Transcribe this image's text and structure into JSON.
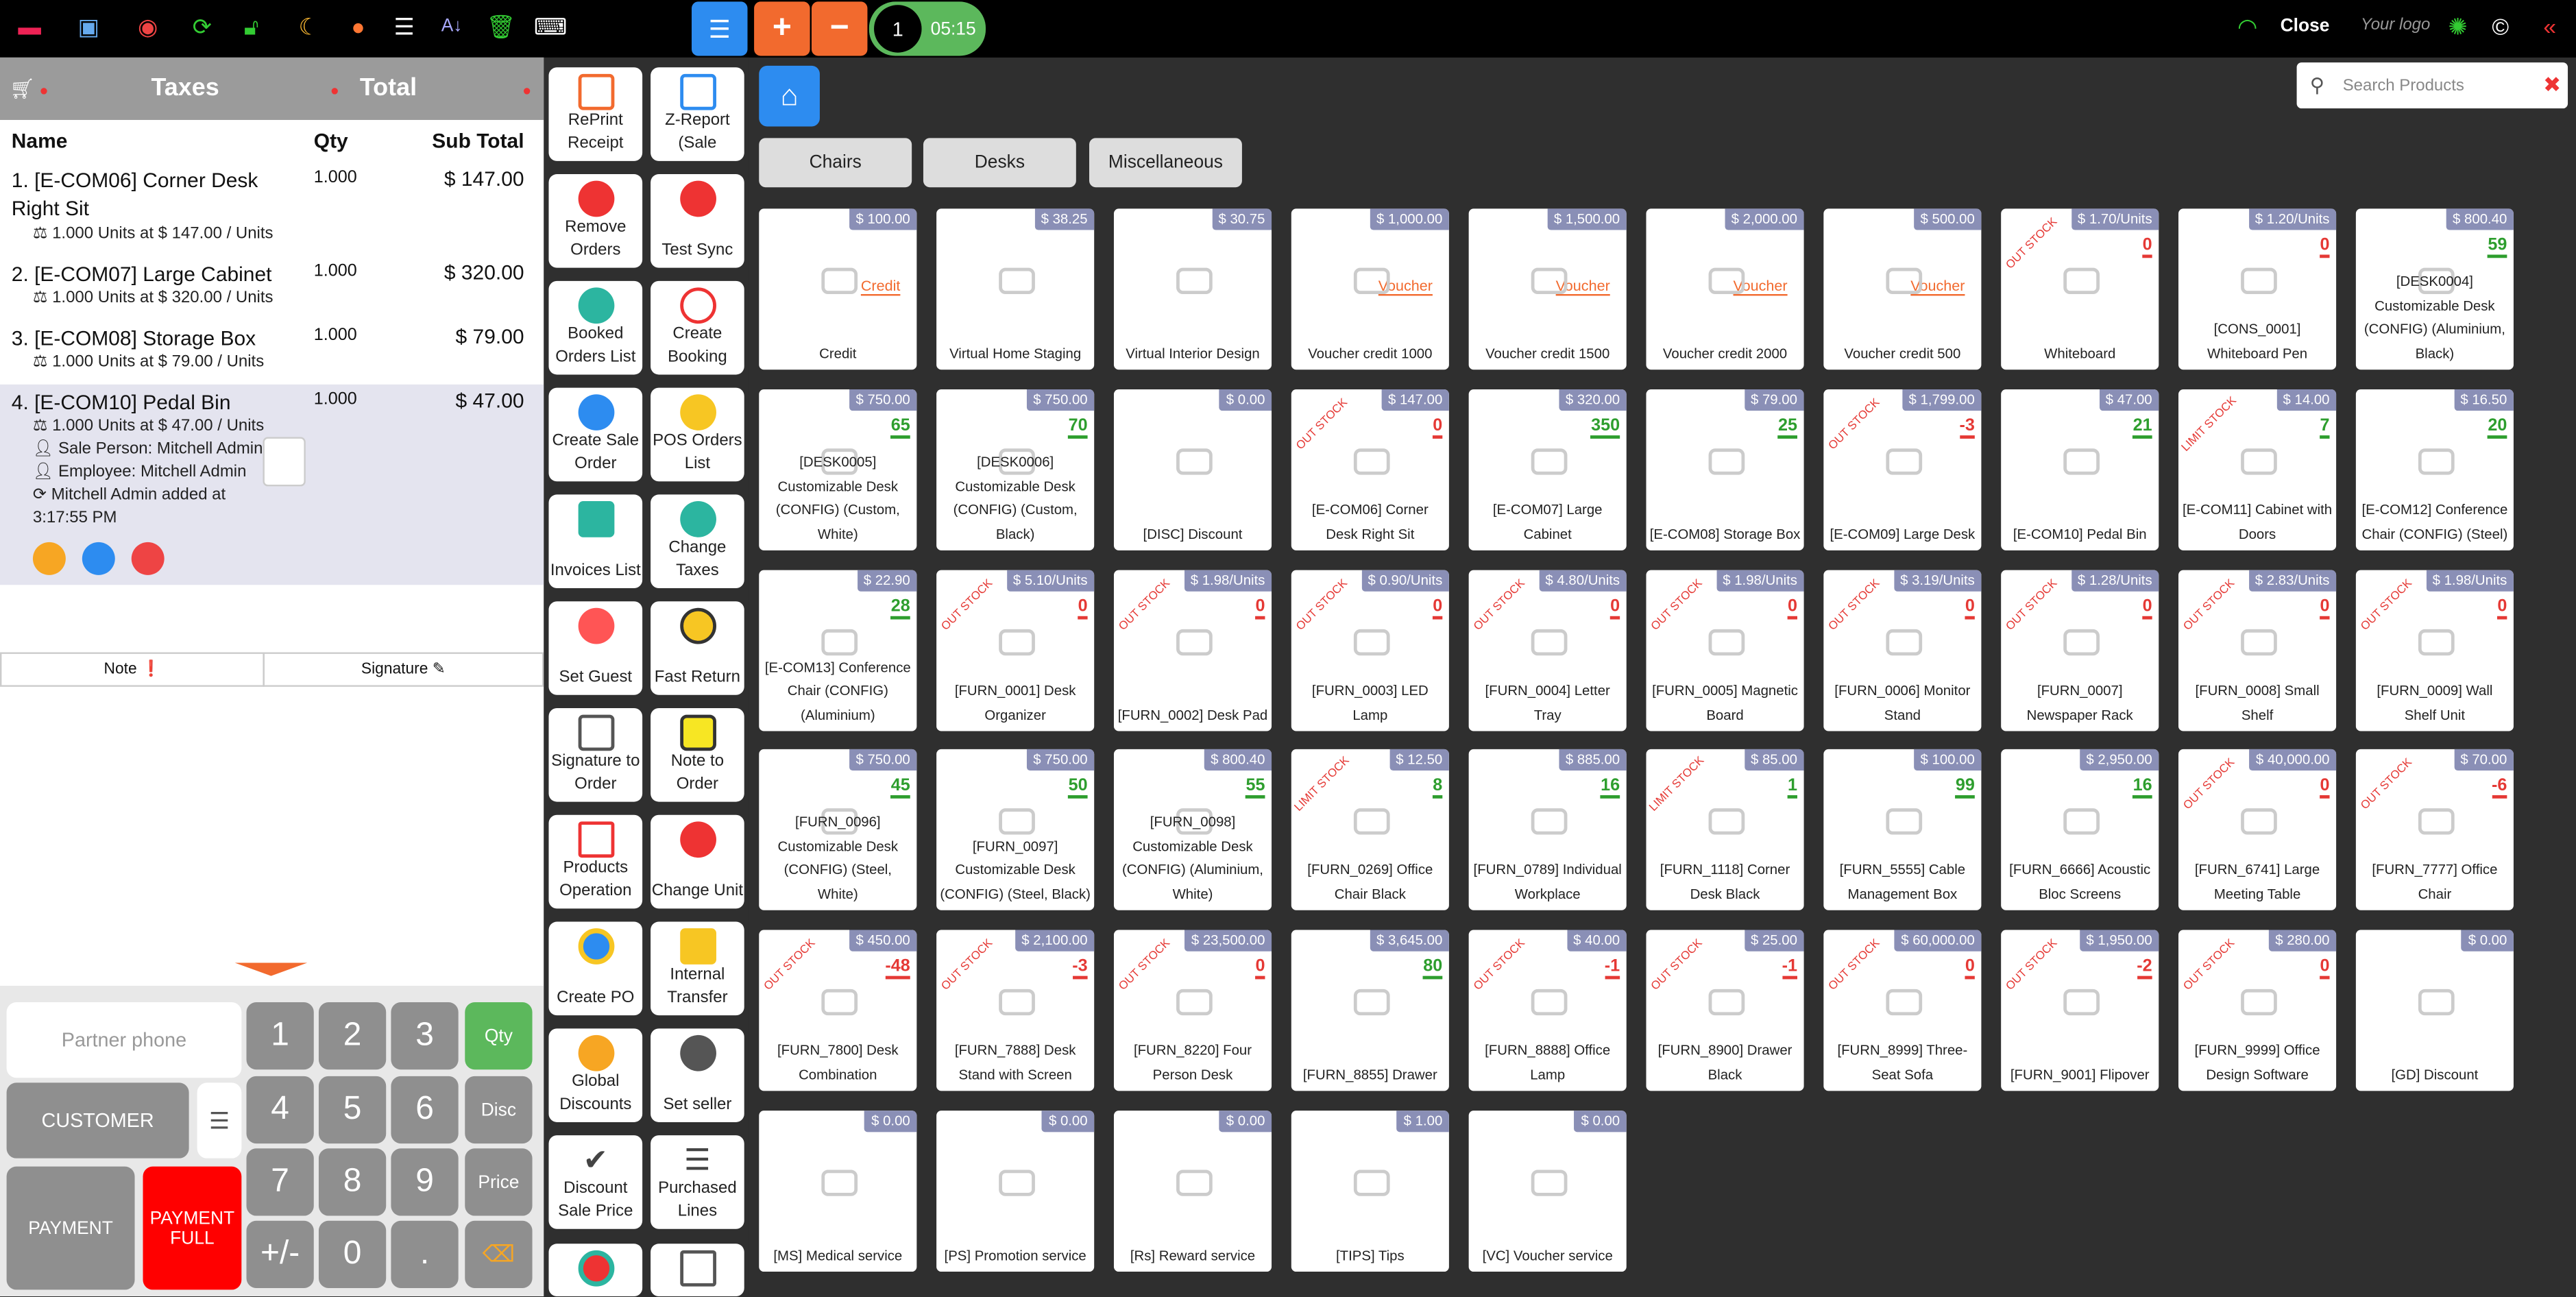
{
  "topbar": {
    "counter": "1",
    "time": "05:15",
    "close": "Close",
    "logo_text": "Your logo"
  },
  "order": {
    "taxes": "Taxes",
    "total": "Total",
    "cols": [
      "Name",
      "Qty",
      "Sub Total"
    ],
    "lines": [
      {
        "name": "1. [E-COM06] Corner Desk Right Sit",
        "qty": "1.000",
        "subtotal": "$ 147.00",
        "detail": "1.000 Units at $ 147.00 / Units"
      },
      {
        "name": "2. [E-COM07] Large Cabinet",
        "qty": "1.000",
        "subtotal": "$ 320.00",
        "detail": "1.000 Units at $ 320.00 / Units"
      },
      {
        "name": "3. [E-COM08] Storage Box",
        "qty": "1.000",
        "subtotal": "$ 79.00",
        "detail": "1.000 Units at $ 79.00 / Units"
      },
      {
        "name": "4. [E-COM10] Pedal Bin",
        "qty": "1.000",
        "subtotal": "$ 47.00",
        "detail": "1.000 Units at $ 47.00 / Units",
        "sale_person": "Sale Person: Mitchell Admin",
        "employee": "Employee: Mitchell Admin",
        "added": "Mitchell Admin added at",
        "added_time": "3:17:55 PM"
      }
    ],
    "note": "Note",
    "signature": "Signature"
  },
  "numpad": {
    "partner_phone": "Partner phone",
    "customer": "CUSTOMER",
    "payment": "PAYMENT",
    "payment_full": "PAYMENT FULL",
    "qty": "Qty",
    "disc": "Disc",
    "price": "Price",
    "keys": [
      "1",
      "2",
      "3",
      "4",
      "5",
      "6",
      "7",
      "8",
      "9",
      "+/-",
      "0",
      "."
    ]
  },
  "actions": [
    [
      "RePrint Receipt",
      "Z-Report (Sale"
    ],
    [
      "Remove Orders",
      "Test Sync"
    ],
    [
      "Booked Orders List",
      "Create Booking"
    ],
    [
      "Create Sale Order",
      "POS Orders List"
    ],
    [
      "Invoices List",
      "Change Taxes"
    ],
    [
      "Set Guest",
      "Fast Return"
    ],
    [
      "Signature to Order",
      "Note to Order"
    ],
    [
      "Products Operation",
      "Change Unit"
    ],
    [
      "Create PO",
      "Internal Transfer"
    ],
    [
      "Global Discounts",
      "Set seller"
    ],
    [
      "Discount Sale Price",
      "Purchased Lines"
    ]
  ],
  "search": {
    "placeholder": "Search Products"
  },
  "categories": [
    "Chairs",
    "Desks",
    "Miscellaneous"
  ],
  "products": [
    {
      "name": "Credit",
      "price": "$ 100.00",
      "voucher": "Credit"
    },
    {
      "name": "Virtual Home Staging",
      "price": "$ 38.25"
    },
    {
      "name": "Virtual Interior Design",
      "price": "$ 30.75"
    },
    {
      "name": "Voucher credit 1000",
      "price": "$ 1,000.00",
      "voucher": "Voucher"
    },
    {
      "name": "Voucher credit 1500",
      "price": "$ 1,500.00",
      "voucher": "Voucher"
    },
    {
      "name": "Voucher credit 2000",
      "price": "$ 2,000.00",
      "voucher": "Voucher"
    },
    {
      "name": "Voucher credit 500",
      "price": "$ 500.00",
      "voucher": "Voucher"
    },
    {
      "name": "Whiteboard",
      "price": "$ 1.70/Units",
      "qty": "0",
      "neg": true,
      "stock": "OUT STOCK"
    },
    {
      "name": "[CONS_0001] Whiteboard Pen",
      "price": "$ 1.20/Units",
      "qty": "0",
      "neg": true
    },
    {
      "name": "[DESK0004] Customizable Desk (CONFIG) (Aluminium, Black)",
      "price": "$ 800.40",
      "qty": "59"
    },
    {
      "name": "[DESK0005] Customizable Desk (CONFIG) (Custom, White)",
      "price": "$ 750.00",
      "qty": "65"
    },
    {
      "name": "[DESK0006] Customizable Desk (CONFIG) (Custom, Black)",
      "price": "$ 750.00",
      "qty": "70"
    },
    {
      "name": "[DISC] Discount",
      "price": "$ 0.00"
    },
    {
      "name": "[E-COM06] Corner Desk Right Sit",
      "price": "$ 147.00",
      "qty": "0",
      "neg": true,
      "stock": "OUT STOCK"
    },
    {
      "name": "[E-COM07] Large Cabinet",
      "price": "$ 320.00",
      "qty": "350"
    },
    {
      "name": "[E-COM08] Storage Box",
      "price": "$ 79.00",
      "qty": "25"
    },
    {
      "name": "[E-COM09] Large Desk",
      "price": "$ 1,799.00",
      "qty": "-3",
      "neg": true,
      "stock": "OUT STOCK"
    },
    {
      "name": "[E-COM10] Pedal Bin",
      "price": "$ 47.00",
      "qty": "21"
    },
    {
      "name": "[E-COM11] Cabinet with Doors",
      "price": "$ 14.00",
      "qty": "7",
      "stock": "LIMIT STOCK"
    },
    {
      "name": "[E-COM12] Conference Chair (CONFIG) (Steel)",
      "price": "$ 16.50",
      "qty": "20"
    },
    {
      "name": "[E-COM13] Conference Chair (CONFIG) (Aluminium)",
      "price": "$ 22.90",
      "qty": "28"
    },
    {
      "name": "[FURN_0001] Desk Organizer",
      "price": "$ 5.10/Units",
      "qty": "0",
      "neg": true,
      "stock": "OUT STOCK"
    },
    {
      "name": "[FURN_0002] Desk Pad",
      "price": "$ 1.98/Units",
      "qty": "0",
      "neg": true,
      "stock": "OUT STOCK"
    },
    {
      "name": "[FURN_0003] LED Lamp",
      "price": "$ 0.90/Units",
      "qty": "0",
      "neg": true,
      "stock": "OUT STOCK"
    },
    {
      "name": "[FURN_0004] Letter Tray",
      "price": "$ 4.80/Units",
      "qty": "0",
      "neg": true,
      "stock": "OUT STOCK"
    },
    {
      "name": "[FURN_0005] Magnetic Board",
      "price": "$ 1.98/Units",
      "qty": "0",
      "neg": true,
      "stock": "OUT STOCK"
    },
    {
      "name": "[FURN_0006] Monitor Stand",
      "price": "$ 3.19/Units",
      "qty": "0",
      "neg": true,
      "stock": "OUT STOCK"
    },
    {
      "name": "[FURN_0007] Newspaper Rack",
      "price": "$ 1.28/Units",
      "qty": "0",
      "neg": true,
      "stock": "OUT STOCK"
    },
    {
      "name": "[FURN_0008] Small Shelf",
      "price": "$ 2.83/Units",
      "qty": "0",
      "neg": true,
      "stock": "OUT STOCK"
    },
    {
      "name": "[FURN_0009] Wall Shelf Unit",
      "price": "$ 1.98/Units",
      "qty": "0",
      "neg": true,
      "stock": "OUT STOCK"
    },
    {
      "name": "[FURN_0096] Customizable Desk (CONFIG) (Steel, White)",
      "price": "$ 750.00",
      "qty": "45"
    },
    {
      "name": "[FURN_0097] Customizable Desk (CONFIG) (Steel, Black)",
      "price": "$ 750.00",
      "qty": "50"
    },
    {
      "name": "[FURN_0098] Customizable Desk (CONFIG) (Aluminium, White)",
      "price": "$ 800.40",
      "qty": "55"
    },
    {
      "name": "[FURN_0269] Office Chair Black",
      "price": "$ 12.50",
      "qty": "8",
      "stock": "LIMIT STOCK"
    },
    {
      "name": "[FURN_0789] Individual Workplace",
      "price": "$ 885.00",
      "qty": "16"
    },
    {
      "name": "[FURN_1118] Corner Desk Black",
      "price": "$ 85.00",
      "qty": "1",
      "stock": "LIMIT STOCK"
    },
    {
      "name": "[FURN_5555] Cable Management Box",
      "price": "$ 100.00",
      "qty": "99"
    },
    {
      "name": "[FURN_6666] Acoustic Bloc Screens",
      "price": "$ 2,950.00",
      "qty": "16"
    },
    {
      "name": "[FURN_6741] Large Meeting Table",
      "price": "$ 40,000.00",
      "qty": "0",
      "neg": true,
      "stock": "OUT STOCK"
    },
    {
      "name": "[FURN_7777] Office Chair",
      "price": "$ 70.00",
      "qty": "-6",
      "neg": true,
      "stock": "OUT STOCK"
    },
    {
      "name": "[FURN_7800] Desk Combination",
      "price": "$ 450.00",
      "qty": "-48",
      "neg": true,
      "stock": "OUT STOCK"
    },
    {
      "name": "[FURN_7888] Desk Stand with Screen",
      "price": "$ 2,100.00",
      "qty": "-3",
      "neg": true,
      "stock": "OUT STOCK"
    },
    {
      "name": "[FURN_8220] Four Person Desk",
      "price": "$ 23,500.00",
      "qty": "0",
      "neg": true,
      "stock": "OUT STOCK"
    },
    {
      "name": "[FURN_8855] Drawer",
      "price": "$ 3,645.00",
      "qty": "80"
    },
    {
      "name": "[FURN_8888] Office Lamp",
      "price": "$ 40.00",
      "qty": "-1",
      "neg": true,
      "stock": "OUT STOCK"
    },
    {
      "name": "[FURN_8900] Drawer Black",
      "price": "$ 25.00",
      "qty": "-1",
      "neg": true,
      "stock": "OUT STOCK"
    },
    {
      "name": "[FURN_8999] Three-Seat Sofa",
      "price": "$ 60,000.00",
      "qty": "0",
      "neg": true,
      "stock": "OUT STOCK"
    },
    {
      "name": "[FURN_9001] Flipover",
      "price": "$ 1,950.00",
      "qty": "-2",
      "neg": true,
      "stock": "OUT STOCK"
    },
    {
      "name": "[FURN_9999] Office Design Software",
      "price": "$ 280.00",
      "qty": "0",
      "neg": true,
      "stock": "OUT STOCK"
    },
    {
      "name": "[GD] Discount",
      "price": "$ 0.00"
    },
    {
      "name": "[MS] Medical service",
      "price": "$ 0.00"
    },
    {
      "name": "[PS] Promotion service",
      "price": "$ 0.00"
    },
    {
      "name": "[Rs] Reward service",
      "price": "$ 0.00"
    },
    {
      "name": "[TIPS] Tips",
      "price": "$ 1.00"
    },
    {
      "name": "[VC] Voucher service",
      "price": "$ 0.00"
    }
  ]
}
